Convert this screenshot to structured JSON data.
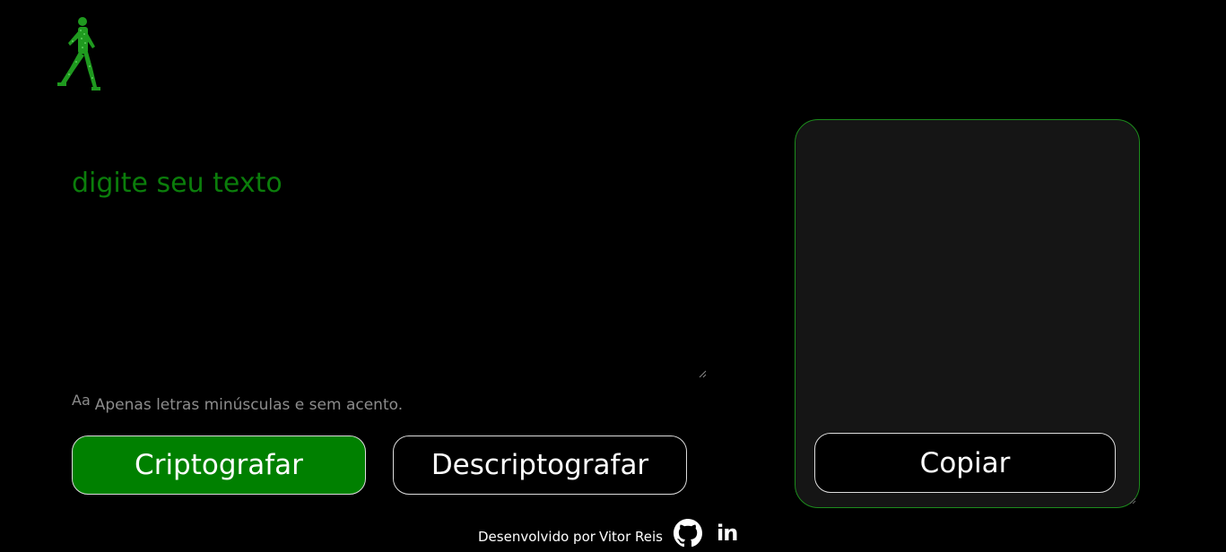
{
  "input": {
    "placeholder": "digite seu texto",
    "value": ""
  },
  "hint": {
    "icon": "Aa",
    "text": "Apenas letras minúsculas e sem acento."
  },
  "buttons": {
    "encrypt_label": "Criptografar",
    "decrypt_label": "Descriptografar"
  },
  "output": {
    "text": "",
    "copy_label": "Copiar"
  },
  "footer": {
    "developed_by": "Desenvolvido por",
    "author": "Vitor Reis",
    "github_icon": "github-icon",
    "linkedin_label": "in"
  },
  "colors": {
    "background": "#000000",
    "accent_green": "#008000",
    "placeholder_green": "#0b7d0b",
    "panel_background": "#151515",
    "panel_border": "#1c8c1c"
  }
}
